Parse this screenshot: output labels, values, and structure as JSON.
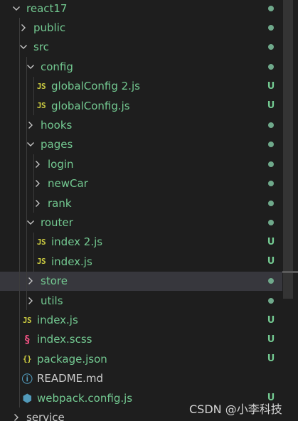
{
  "colors": {
    "background": "#1e1e1e",
    "selected_row": "#37373d",
    "untracked_green": "#73c991",
    "js_icon": "#cbcb41",
    "scss_icon": "#f55385",
    "json_icon": "#cbcb41",
    "info_icon": "#519aba",
    "webpack_icon": "#519aba",
    "dot": "#6fa98b"
  },
  "explorer": {
    "items": [
      {
        "label": "react17",
        "kind": "folder",
        "expanded": true,
        "icon": "chevron-down-icon",
        "depth": 0,
        "badge": "dot"
      },
      {
        "label": "public",
        "kind": "folder",
        "expanded": false,
        "icon": "chevron-right-icon",
        "depth": 1,
        "badge": "dot"
      },
      {
        "label": "src",
        "kind": "folder",
        "expanded": true,
        "icon": "chevron-down-icon",
        "depth": 1,
        "badge": "dot"
      },
      {
        "label": "config",
        "kind": "folder",
        "expanded": true,
        "icon": "chevron-down-icon",
        "depth": 2,
        "badge": "dot"
      },
      {
        "label": "globalConfig 2.js",
        "kind": "file",
        "icon": "js-file-icon",
        "icon_text": "JS",
        "depth": 3,
        "badge": "U"
      },
      {
        "label": "globalConfig.js",
        "kind": "file",
        "icon": "js-file-icon",
        "icon_text": "JS",
        "depth": 3,
        "badge": "U"
      },
      {
        "label": "hooks",
        "kind": "folder",
        "expanded": false,
        "icon": "chevron-right-icon",
        "depth": 2,
        "badge": "dot"
      },
      {
        "label": "pages",
        "kind": "folder",
        "expanded": true,
        "icon": "chevron-down-icon",
        "depth": 2,
        "badge": "dot"
      },
      {
        "label": "login",
        "kind": "folder",
        "expanded": false,
        "icon": "chevron-right-icon",
        "depth": 3,
        "badge": "dot"
      },
      {
        "label": "newCar",
        "kind": "folder",
        "expanded": false,
        "icon": "chevron-right-icon",
        "depth": 3,
        "badge": "dot"
      },
      {
        "label": "rank",
        "kind": "folder",
        "expanded": false,
        "icon": "chevron-right-icon",
        "depth": 3,
        "badge": "dot"
      },
      {
        "label": "router",
        "kind": "folder",
        "expanded": true,
        "icon": "chevron-down-icon",
        "depth": 2,
        "badge": "dot"
      },
      {
        "label": "index 2.js",
        "kind": "file",
        "icon": "js-file-icon",
        "icon_text": "JS",
        "depth": 3,
        "badge": "U"
      },
      {
        "label": "index.js",
        "kind": "file",
        "icon": "js-file-icon",
        "icon_text": "JS",
        "depth": 3,
        "badge": "U"
      },
      {
        "label": "store",
        "kind": "folder",
        "expanded": false,
        "icon": "chevron-right-icon",
        "depth": 2,
        "badge": "dot",
        "selected": true
      },
      {
        "label": "utils",
        "kind": "folder",
        "expanded": false,
        "icon": "chevron-right-icon",
        "depth": 2,
        "badge": "dot"
      },
      {
        "label": "index.js",
        "kind": "file",
        "icon": "js-file-icon",
        "icon_text": "JS",
        "depth": 1,
        "badge": "U"
      },
      {
        "label": "index.scss",
        "kind": "file",
        "icon": "scss-file-icon",
        "icon_text": "§",
        "depth": 1,
        "badge": "U"
      },
      {
        "label": "package.json",
        "kind": "file",
        "icon": "json-file-icon",
        "icon_text": "{}",
        "depth": 1,
        "badge": "U"
      },
      {
        "label": "README.md",
        "kind": "file",
        "icon": "info-icon",
        "icon_text": "ⓘ",
        "depth": 1,
        "badge": "",
        "plain": true
      },
      {
        "label": "webpack.config.js",
        "kind": "file",
        "icon": "webpack-icon",
        "icon_text": "⬢",
        "depth": 1,
        "badge": "U"
      },
      {
        "label": "service",
        "kind": "folder",
        "expanded": false,
        "icon": "chevron-right-icon",
        "depth": 0,
        "badge": "",
        "plain": true
      }
    ]
  },
  "watermark": "CSDN @小李科技"
}
